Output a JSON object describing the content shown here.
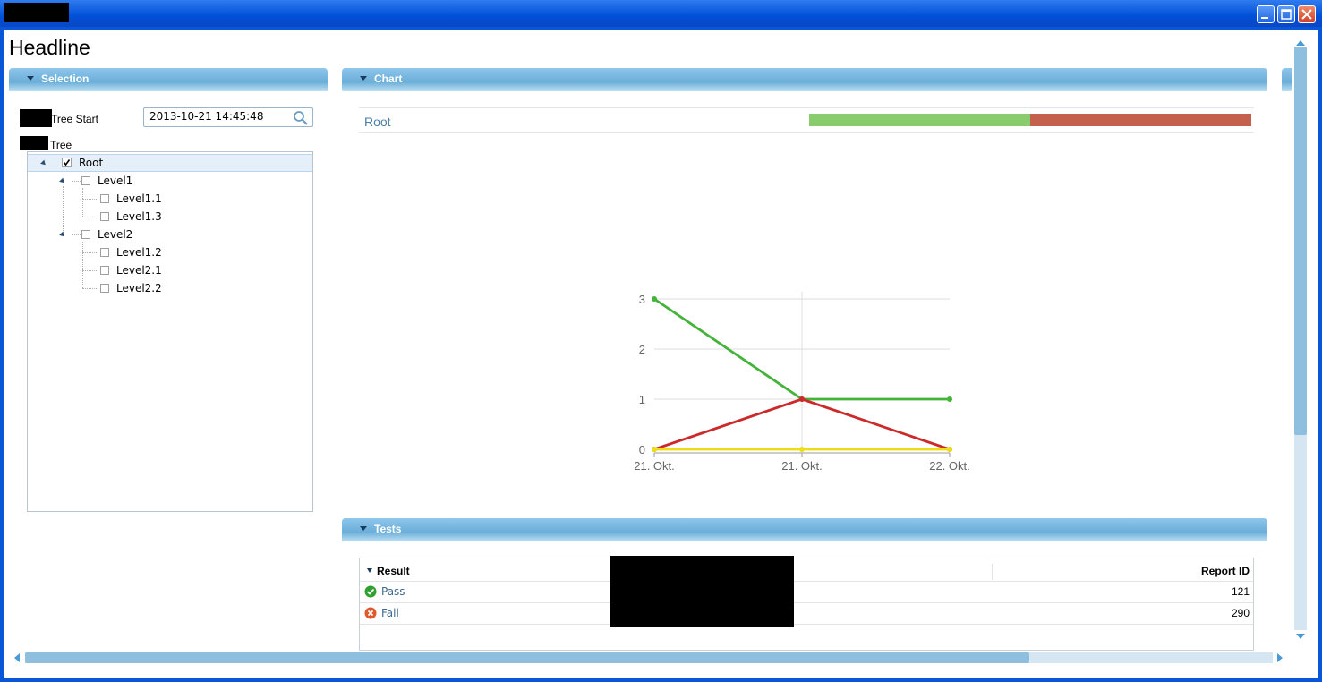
{
  "window": {
    "title": ""
  },
  "page": {
    "headline": "Headline"
  },
  "selection": {
    "header": "Selection",
    "tree_start_label": "Tree Start",
    "date_value": "2013-10-21 14:45:48",
    "tree_label": "Tree",
    "tree": {
      "root": "Root",
      "level1": "Level1",
      "level1_1": "Level1.1",
      "level1_3": "Level1.3",
      "level2": "Level2",
      "level1_2": "Level1.2",
      "level2_1": "Level2.1",
      "level2_2": "Level2.2"
    }
  },
  "chart_panel": {
    "header": "Chart",
    "summary_label": "Root",
    "summary_bar": {
      "pass_fraction": 0.5,
      "fail_fraction": 0.5,
      "pass_color": "#88cc6e",
      "fail_color": "#c4614d"
    }
  },
  "chart_data": {
    "type": "line",
    "categories": [
      "21. Okt.",
      "21. Okt.",
      "22. Okt."
    ],
    "series": [
      {
        "color": "#44b33a",
        "values": [
          3,
          1,
          1
        ]
      },
      {
        "color": "#cc2a2a",
        "values": [
          0,
          1,
          0
        ]
      },
      {
        "color": "#eedd11",
        "values": [
          0,
          0,
          0
        ]
      }
    ],
    "yticks": [
      "0",
      "1",
      "2",
      "3"
    ],
    "ylim": [
      0,
      3
    ],
    "grid": true,
    "legend": "none"
  },
  "tests": {
    "header": "Tests",
    "columns": {
      "result": "Result",
      "report_id": "Report ID"
    },
    "rows": [
      {
        "result": "Pass",
        "report_id": "121",
        "status_color": "#2ea02e"
      },
      {
        "result": "Fail",
        "report_id": "290",
        "status_color": "#e0582c"
      }
    ]
  }
}
